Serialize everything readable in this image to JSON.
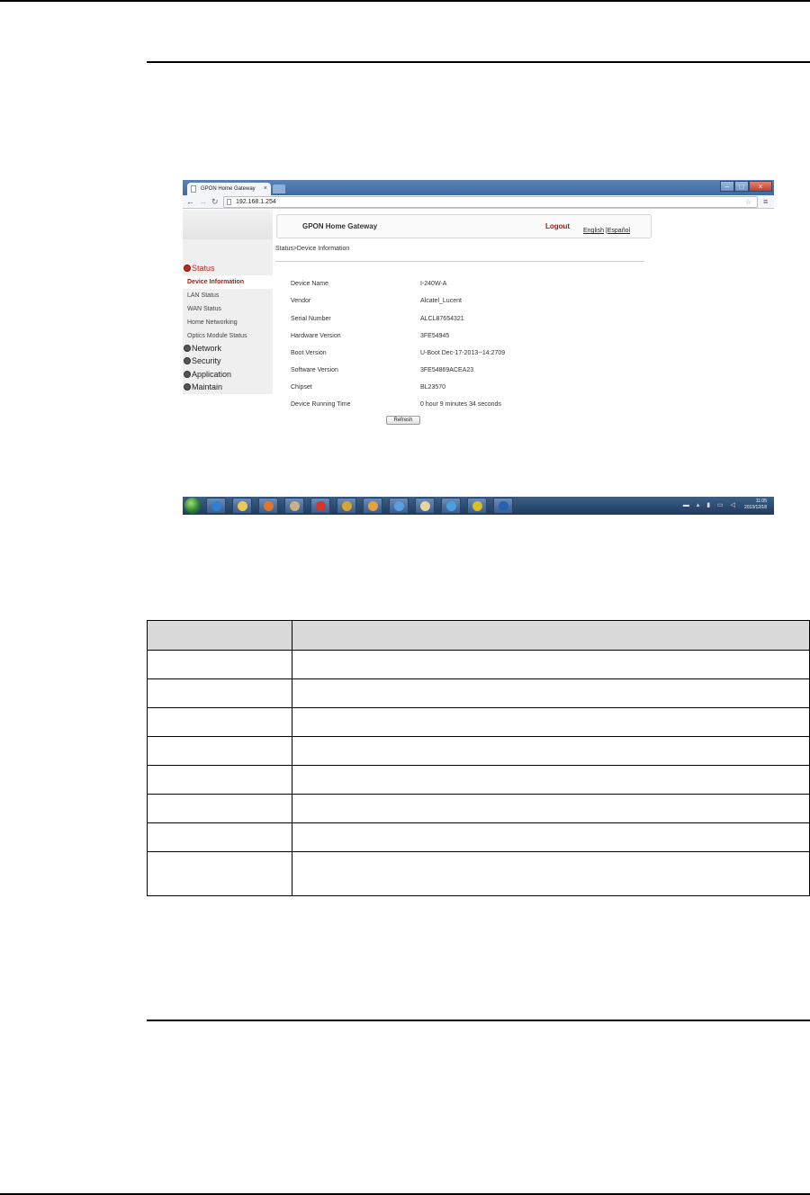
{
  "browser": {
    "tab_title": "GPON Home Gateway",
    "tab_close": "×",
    "address": "192.168.1.254",
    "window_controls": {
      "min": "–",
      "max": "□",
      "close": "×"
    }
  },
  "gateway": {
    "banner_title": "GPON Home Gateway",
    "logout": "Logout",
    "lang_english": "English",
    "lang_separator": " |",
    "lang_spanish": "Español",
    "breadcrumb": "Status>Device Information",
    "sidebar": {
      "status": "Status",
      "items": [
        "Device Information",
        "LAN Status",
        "WAN Status",
        "Home Networking",
        "Optics Module Status"
      ],
      "network": "Network",
      "security": "Security",
      "application": "Application",
      "maintain": "Maintain"
    },
    "device_info": [
      {
        "label": "Device Name",
        "value": "I-240W-A"
      },
      {
        "label": "Vendor",
        "value": "Alcatel_Lucent"
      },
      {
        "label": "Serial Number",
        "value": "ALCL87654321"
      },
      {
        "label": "Hardware Version",
        "value": "3FE54945"
      },
      {
        "label": "Boot Version",
        "value": "U-Boot Dec-17-2013--14:2709"
      },
      {
        "label": "Software Version",
        "value": "3FE54869ACEA23"
      },
      {
        "label": "Chipset",
        "value": "BL23570"
      },
      {
        "label": "Device Running Time",
        "value": "0 hour 9 minutes 34 seconds"
      }
    ],
    "refresh": "Refresh"
  },
  "taskbar": {
    "time": "11:05",
    "date": "2013/12/18",
    "icon_colors": [
      "#2f7fd6",
      "#e8c95a",
      "#e3742a",
      "#c8b18a",
      "#d9342b",
      "#d9a43a",
      "#e8a13a",
      "#5aa0e0",
      "#e6d3a0",
      "#4a9fe0",
      "#d8c020",
      "#2a5fb0"
    ]
  }
}
